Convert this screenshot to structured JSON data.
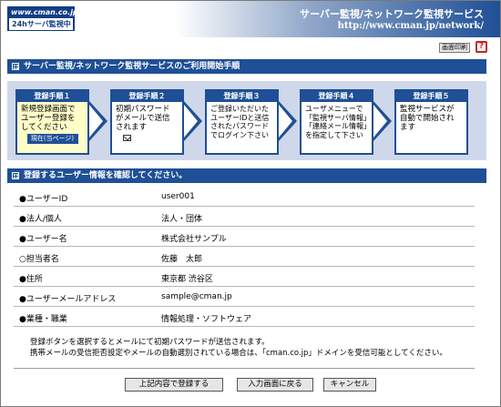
{
  "header": {
    "logo_top": "www.cman.co.jp",
    "logo_bottom": "24hサーバ監視中",
    "title": "サーバー監視/ネットワーク監視サービス",
    "url": "http://www.cman.jp/network/"
  },
  "toolbar": {
    "print_label": "画面印刷",
    "help_label": "?"
  },
  "steps_section": {
    "title": "サーバー監視/ネットワーク監視サービスのご利用開始手順",
    "steps": [
      {
        "head": "登録手順１",
        "lines": [
          "新規登録画面で",
          "ユーザー登録を",
          "してください"
        ],
        "current_label": "現在(当ページ)"
      },
      {
        "head": "登録手順２",
        "lines": [
          "初期パスワード",
          "がメールで送信",
          "されます"
        ]
      },
      {
        "head": "登録手順３",
        "lines": [
          "ご登録いただいた",
          "ユーザーIDと送信",
          "されたパスワード",
          "でログイン下さい"
        ]
      },
      {
        "head": "登録手順４",
        "lines": [
          "ユーザメニューで",
          "「監視サーバ情報」",
          "「連絡メール情報」",
          "を指定して下さい"
        ]
      },
      {
        "head": "登録手順５",
        "lines": [
          "監視サービスが",
          "自動で開始され",
          "ます"
        ]
      }
    ]
  },
  "confirm_section": {
    "title": "登録するユーザー情報を確認してください。",
    "rows": [
      {
        "label": "●ユーザーID",
        "value": "user001"
      },
      {
        "label": "●法人/個人",
        "value": "法人・団体"
      },
      {
        "label": "●ユーザー名",
        "value": "株式会社サンプル"
      },
      {
        "label": "○担当者名",
        "value": "佐藤　太郎"
      },
      {
        "label": "●住所",
        "value": "東京都 渋谷区"
      },
      {
        "label": "●ユーザーメールアドレス",
        "value": "sample@cman.jp"
      },
      {
        "label": "●業種・職業",
        "value": "情報処理・ソフトウェア"
      }
    ],
    "note_1": "登録ボタンを選択するとメールにて初期パスワードが送信されます。",
    "note_2": "携帯メールの受信拒否設定やメールの自動選別されている場合は、「cman.co.jp」ドメインを受信可能としてください。"
  },
  "buttons": {
    "register": "上記内容で登録する",
    "back": "入力画面に戻る",
    "cancel": "キャンセル"
  },
  "colors": {
    "primary": "#1f4f96",
    "step_band": "#cfd8ea",
    "active_step": "#fffdc8",
    "help": "#d02020"
  }
}
